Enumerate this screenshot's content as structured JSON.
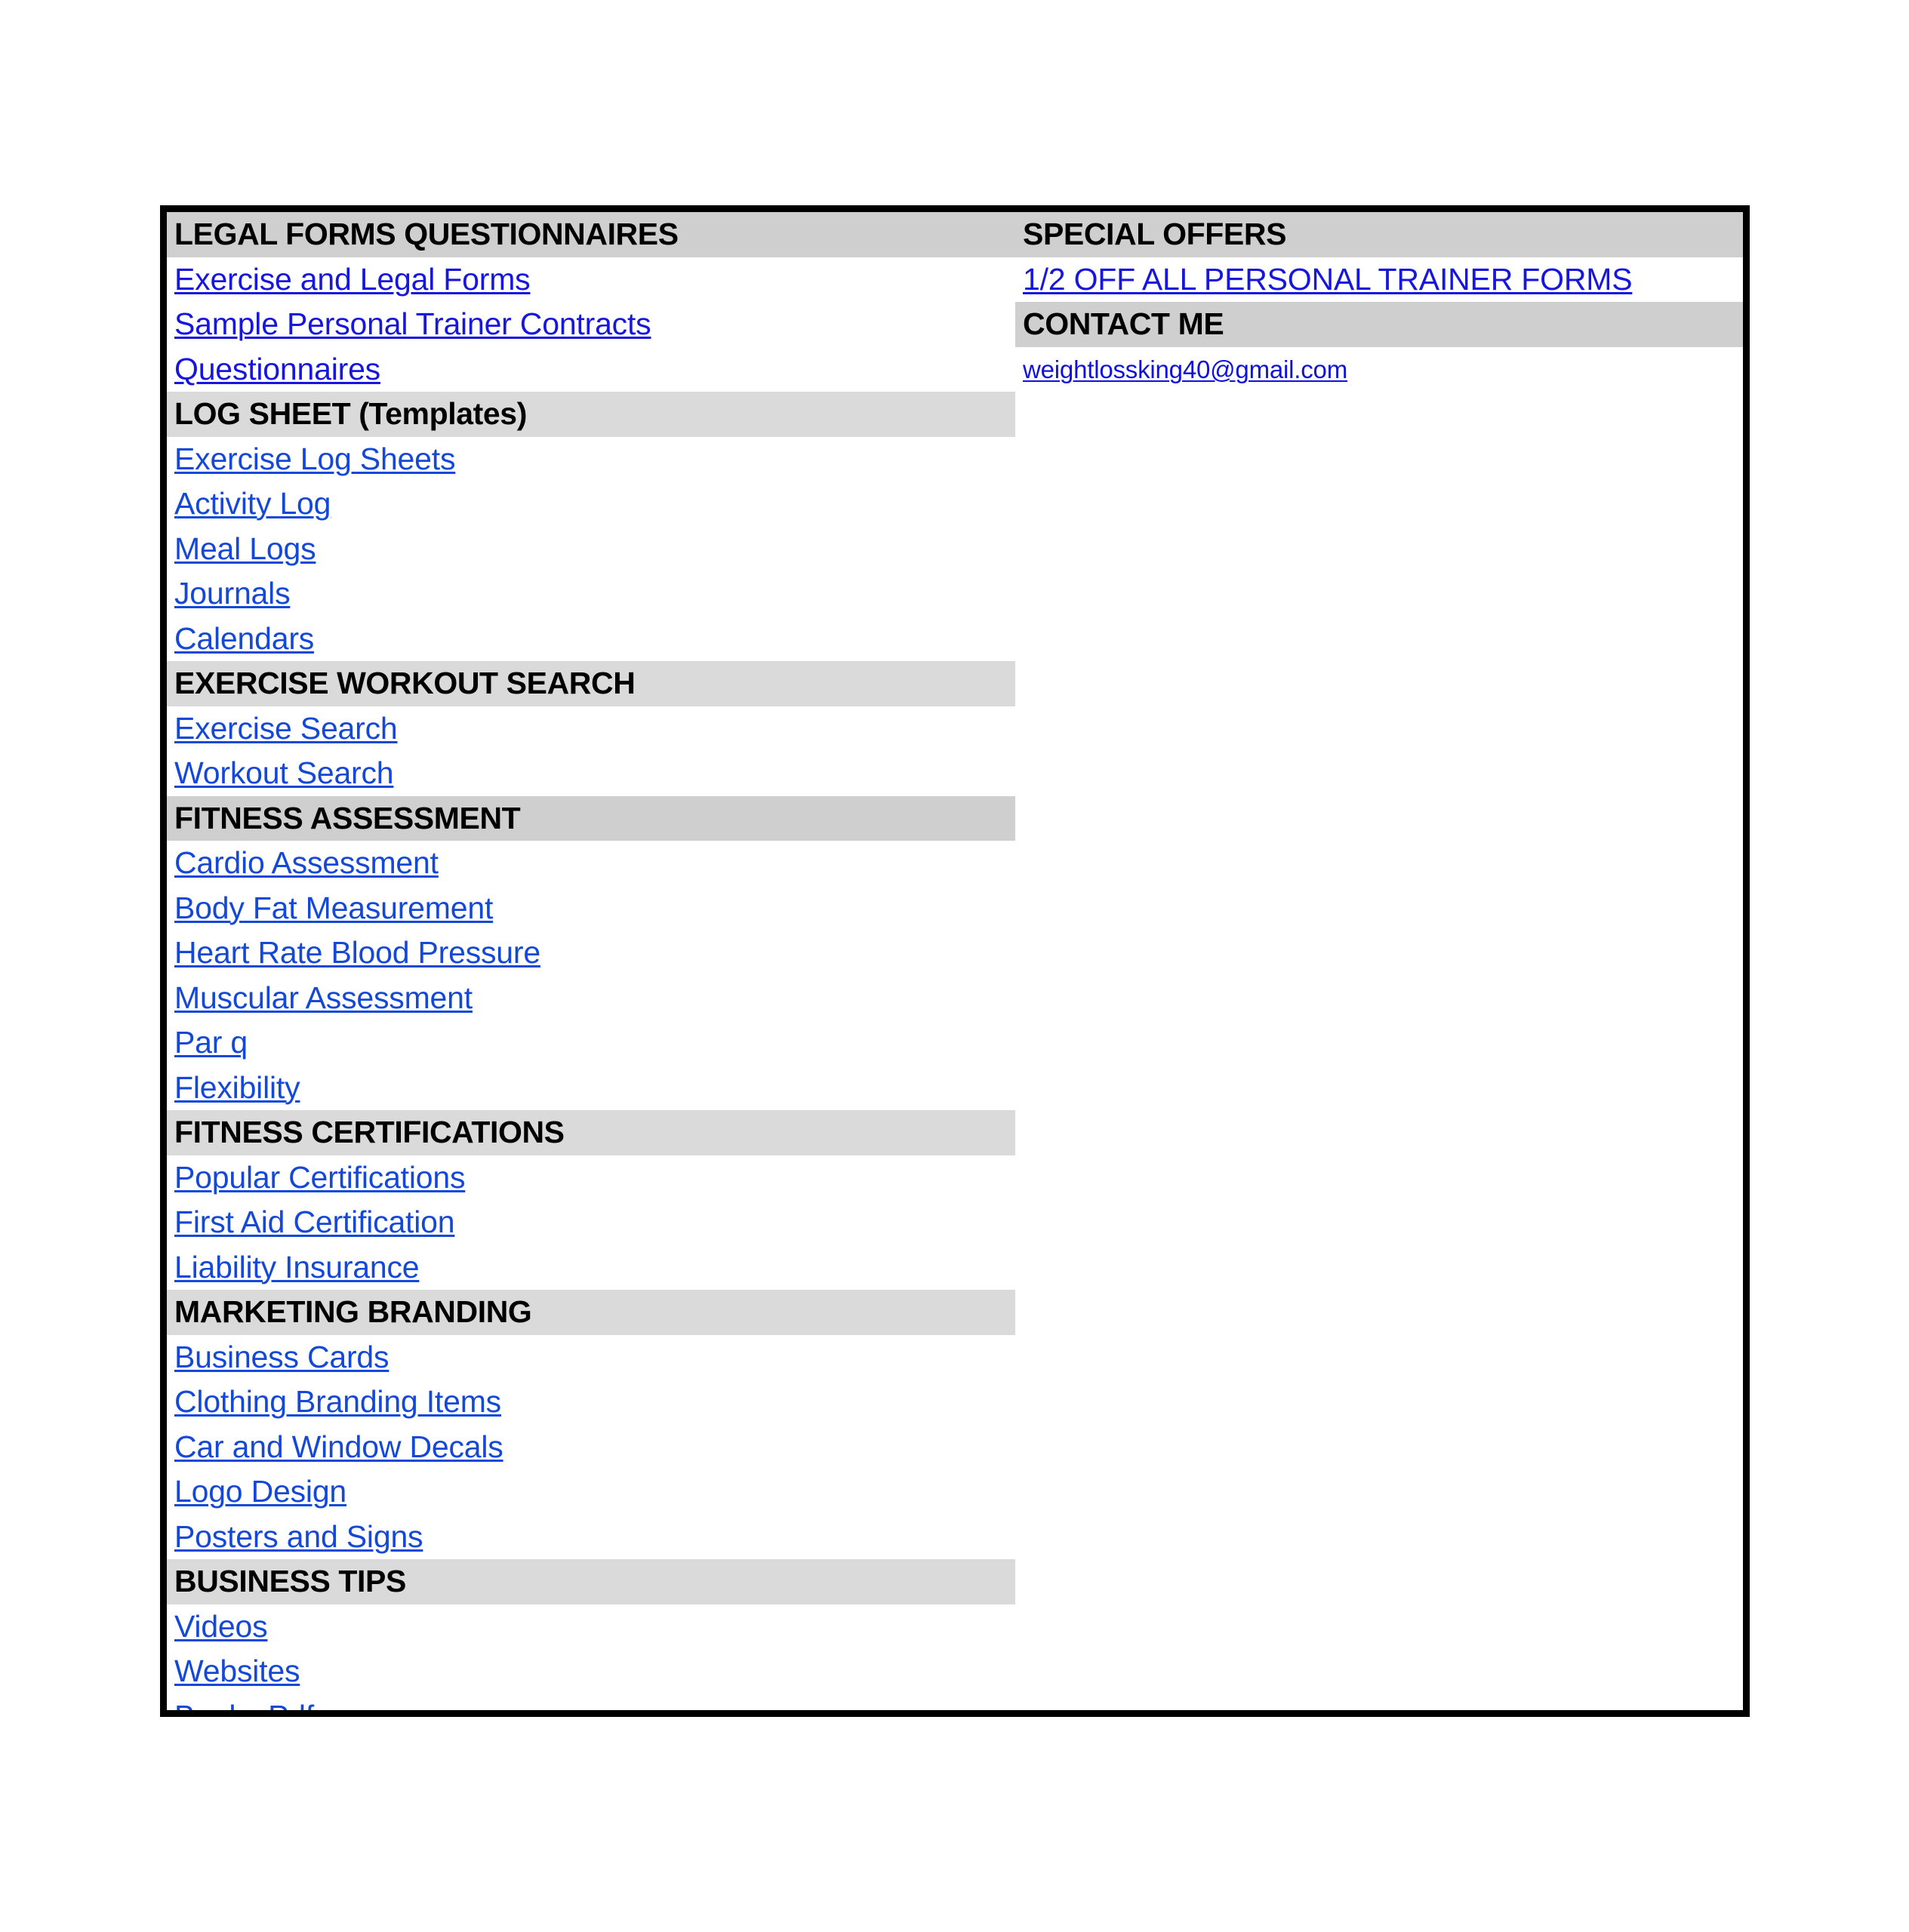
{
  "sidebar": {
    "left_column": [
      {
        "type": "header",
        "shade": "dark",
        "label": "LEGAL FORMS QUESTIONNAIRES"
      },
      {
        "type": "link",
        "shade": "deep",
        "label": "Exercise and Legal Forms "
      },
      {
        "type": "link",
        "shade": "deep",
        "label": "Sample Personal Trainer Contracts"
      },
      {
        "type": "link",
        "shade": "deep",
        "label": "Questionnaires"
      },
      {
        "type": "header",
        "shade": "light",
        "label": "LOG SHEET (Templates)"
      },
      {
        "type": "link",
        "shade": "mid",
        "label": "Exercise Log Sheets"
      },
      {
        "type": "link",
        "shade": "mid",
        "label": "Activity Log"
      },
      {
        "type": "link",
        "shade": "mid",
        "label": "Meal Logs"
      },
      {
        "type": "link",
        "shade": "mid",
        "label": "Journals"
      },
      {
        "type": "link",
        "shade": "mid",
        "label": "Calendars"
      },
      {
        "type": "header",
        "shade": "light",
        "label": "EXERCISE WORKOUT SEARCH"
      },
      {
        "type": "link",
        "shade": "mid",
        "label": "Exercise Search"
      },
      {
        "type": "link",
        "shade": "mid",
        "label": "Workout Search"
      },
      {
        "type": "header",
        "shade": "dark",
        "label": "FITNESS ASSESSMENT"
      },
      {
        "type": "link",
        "shade": "mid",
        "label": "Cardio Assessment"
      },
      {
        "type": "link",
        "shade": "mid",
        "label": "Body Fat Measurement"
      },
      {
        "type": "link",
        "shade": "mid",
        "label": "Heart Rate Blood Pressure"
      },
      {
        "type": "link",
        "shade": "mid",
        "label": "Muscular Assessment"
      },
      {
        "type": "link",
        "shade": "mid",
        "label": "Par q"
      },
      {
        "type": "link",
        "shade": "mid",
        "label": "Flexibility"
      },
      {
        "type": "header",
        "shade": "light",
        "label": "FITNESS CERTIFICATIONS"
      },
      {
        "type": "link",
        "shade": "mid",
        "label": "Popular Certifications"
      },
      {
        "type": "link",
        "shade": "mid",
        "label": "First Aid Certification"
      },
      {
        "type": "link",
        "shade": "mid",
        "label": "Liability Insurance"
      },
      {
        "type": "header",
        "shade": "light",
        "label": "MARKETING BRANDING"
      },
      {
        "type": "link",
        "shade": "mid",
        "label": "Business Cards"
      },
      {
        "type": "link",
        "shade": "mid",
        "label": "Clothing Branding Items"
      },
      {
        "type": "link",
        "shade": "mid",
        "label": "Car and Window Decals"
      },
      {
        "type": "link",
        "shade": "mid",
        "label": "Logo Design"
      },
      {
        "type": "link",
        "shade": "mid",
        "label": "Posters and Signs"
      },
      {
        "type": "header",
        "shade": "light",
        "label": "BUSINESS TIPS"
      },
      {
        "type": "link",
        "shade": "mid",
        "label": "Videos"
      },
      {
        "type": "link",
        "shade": "mid",
        "label": "Websites"
      },
      {
        "type": "link",
        "shade": "mid",
        "label": "Books Pdf"
      }
    ],
    "right_column": [
      {
        "type": "header",
        "shade": "dark",
        "label": "SPECIAL OFFERS"
      },
      {
        "type": "link",
        "shade": "offer",
        "label": "1/2 OFF ALL PERSONAL TRAINER FORMS"
      },
      {
        "type": "header",
        "shade": "dark",
        "label": "CONTACT ME"
      },
      {
        "type": "link",
        "shade": "email",
        "label": "weightlossking40@gmail.com"
      }
    ]
  },
  "colors": {
    "border": "#000000",
    "header_band_dark": "#cfcfcf",
    "header_band_light": "#dadada",
    "link_blue": "#1448d8",
    "link_blue_deep": "#1616e0",
    "page_background": "#ffffff"
  }
}
